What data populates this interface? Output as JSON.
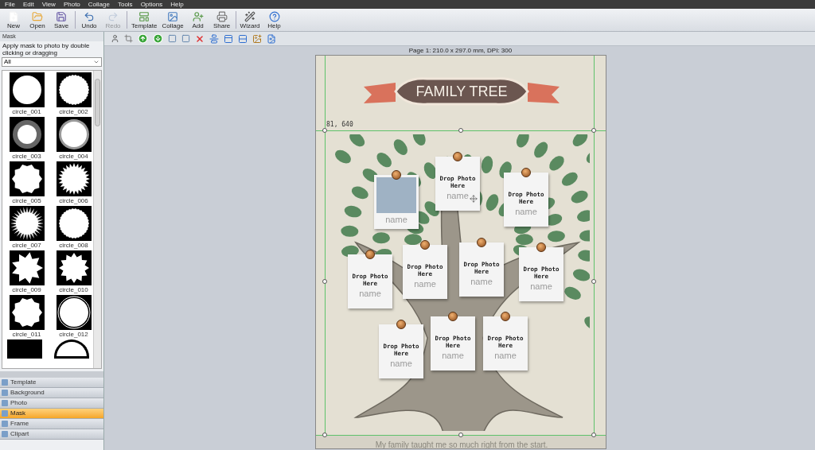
{
  "menu": [
    "File",
    "Edit",
    "View",
    "Photo",
    "Collage",
    "Tools",
    "Options",
    "Help"
  ],
  "toolbar": [
    {
      "label": "New",
      "disabled": false
    },
    {
      "label": "Open",
      "disabled": false
    },
    {
      "label": "Save",
      "disabled": false
    },
    {
      "label": "Undo",
      "disabled": false
    },
    {
      "label": "Redo",
      "disabled": true
    },
    {
      "label": "Template",
      "disabled": false
    },
    {
      "label": "Collage",
      "disabled": false
    },
    {
      "label": "Add",
      "disabled": false
    },
    {
      "label": "Share",
      "disabled": false
    },
    {
      "label": "Wizard",
      "disabled": false
    },
    {
      "label": "Help",
      "disabled": false
    }
  ],
  "left_panel": {
    "title": "Mask",
    "hint": "Apply mask to photo by double clicking or dragging",
    "filter": "All",
    "masks": [
      {
        "label": "circle_001",
        "kind": "solid"
      },
      {
        "label": "circle_002",
        "kind": "rough"
      },
      {
        "label": "circle_003",
        "kind": "blur"
      },
      {
        "label": "circle_004",
        "kind": "soft"
      },
      {
        "label": "circle_005",
        "kind": "wavy"
      },
      {
        "label": "circle_006",
        "kind": "saw"
      },
      {
        "label": "circle_007",
        "kind": "burst"
      },
      {
        "label": "circle_008",
        "kind": "rough"
      },
      {
        "label": "circle_009",
        "kind": "star"
      },
      {
        "label": "circle_010",
        "kind": "gear"
      },
      {
        "label": "circle_011",
        "kind": "wavy"
      },
      {
        "label": "circle_012",
        "kind": "ring"
      }
    ],
    "tabs": [
      {
        "label": "Template",
        "selected": false
      },
      {
        "label": "Background",
        "selected": false
      },
      {
        "label": "Photo",
        "selected": false
      },
      {
        "label": "Mask",
        "selected": true
      },
      {
        "label": "Frame",
        "selected": false
      },
      {
        "label": "Clipart",
        "selected": false
      }
    ]
  },
  "canvas": {
    "page_info": "Page 1: 210.0 x 297.0 mm, DPI: 300",
    "title": "FAMILY TREE",
    "coords": "81, 640",
    "cards": [
      {
        "kind": "photo",
        "label": "name"
      },
      {
        "kind": "empty",
        "drop": "Drop Photo Here",
        "label": "name"
      },
      {
        "kind": "empty",
        "drop": "Drop Photo Here",
        "label": "name"
      },
      {
        "kind": "empty",
        "drop": "Drop Photo Here",
        "label": "name"
      },
      {
        "kind": "empty",
        "drop": "Drop Photo Here",
        "label": "name"
      },
      {
        "kind": "empty",
        "drop": "Drop Photo Here",
        "label": "name"
      },
      {
        "kind": "empty",
        "drop": "Drop Photo Here",
        "label": "name"
      },
      {
        "kind": "empty",
        "drop": "Drop Photo Here",
        "label": "name"
      },
      {
        "kind": "empty",
        "drop": "Drop Photo Here",
        "label": "name"
      },
      {
        "kind": "empty",
        "drop": "Drop Photo Here",
        "label": "name"
      }
    ],
    "caption": "My family taught me so much right from the start."
  }
}
